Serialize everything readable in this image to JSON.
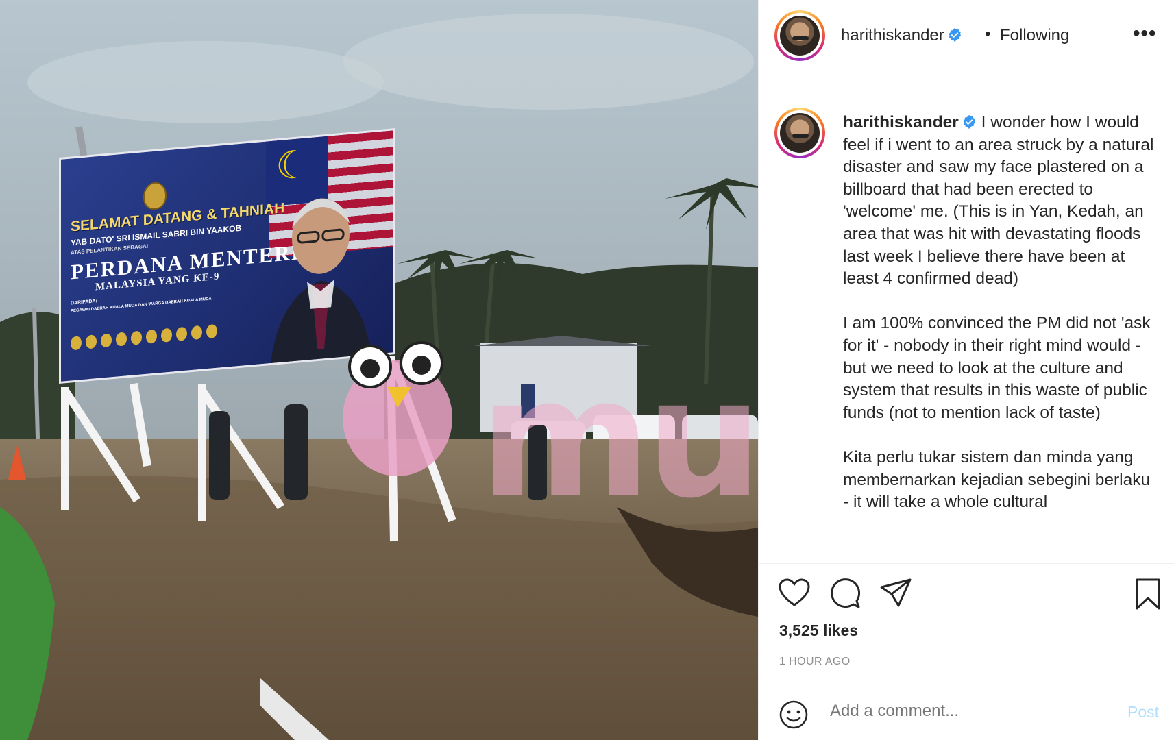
{
  "post": {
    "username": "harithiskander",
    "follow_status": "Following",
    "separator": "•",
    "more_icon": "more-options-icon",
    "verified_icon": "verified-badge-icon"
  },
  "photo": {
    "billboard": {
      "line1": "SELAMAT DATANG & TAHNIAH",
      "line2": "YAB DATO' SRI ISMAIL SABRI BIN YAAKOB",
      "line3": "ATAS PELANTIKAN SEBAGAI",
      "line4": "PERDANA MENTERI",
      "line5": "MALAYSIA YANG KE-9",
      "line6": "DARIPADA:",
      "line7": "PEGAWAI DAERAH KUALA MUDA DAN WARGA DAERAH KUALA MUDA"
    },
    "watermark": "murai"
  },
  "caption": {
    "username": "harithiskander",
    "text": " I wonder how I would feel if i went to an area struck by a natural disaster and saw my face plastered on a billboard that had been erected to 'welcome' me. (This is in Yan, Kedah, an area that was hit with devastating floods last week I believe there have been at least 4 confirmed dead)\n\nI am 100% convinced the PM did not 'ask for it' - nobody in their right mind would - but we need to look at the culture and system that results in this waste of public funds (not to mention lack of taste)\n\nKita perlu tukar sistem dan minda yang membernarkan kejadian sebegini berlaku - it will take a whole cultural"
  },
  "actions": {
    "like_icon": "heart-icon",
    "comment_icon": "comment-icon",
    "share_icon": "share-icon",
    "save_icon": "bookmark-icon",
    "likes": "3,525 likes",
    "timestamp": "1 HOUR AGO"
  },
  "comment": {
    "emoji_icon": "emoji-icon",
    "placeholder": "Add a comment...",
    "post_label": "Post"
  }
}
